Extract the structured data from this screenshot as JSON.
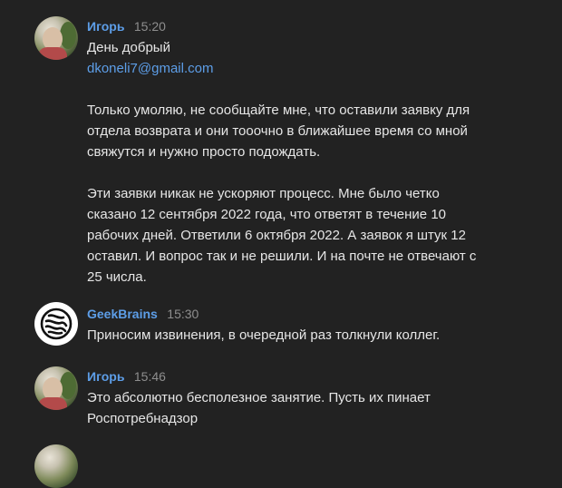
{
  "messages": [
    {
      "author": "Игорь",
      "time": "15:20",
      "greeting": "День добрый",
      "email": "dkoneli7@gmail.com",
      "para1": [
        "Только умоляю, не сообщайте мне, что оставили заявку для",
        "отдела возврата и они тооочно в ближайшее время со мной",
        "свяжутся и нужно просто подождать."
      ],
      "para2": [
        "Эти заявки никак не ускоряют процесс. Мне было четко",
        "сказано 12 сентября 2022 года, что ответят в течение 10",
        "рабочих дней. Ответили 6 октября 2022. А заявок я штук 12",
        "оставил. И вопрос так и не решили. И на почте не отвечают с",
        "25 числа."
      ]
    },
    {
      "author": "GeekBrains",
      "time": "15:30",
      "text": "Приносим извинения, в очередной раз толкнули коллег."
    },
    {
      "author": "Игорь",
      "time": "15:46",
      "lines": [
        "Это абсолютно бесполезное занятие. Пусть их пинает",
        "Роспотребнадзор"
      ]
    }
  ],
  "icons": {
    "user_avatar": "user-photo-avatar",
    "company_avatar": "geekbrains-logo"
  },
  "colors": {
    "background": "#222222",
    "author": "#5d9ee8",
    "link": "#5d9ee8",
    "time": "#8e8e8e",
    "text": "#e6e6e6"
  }
}
